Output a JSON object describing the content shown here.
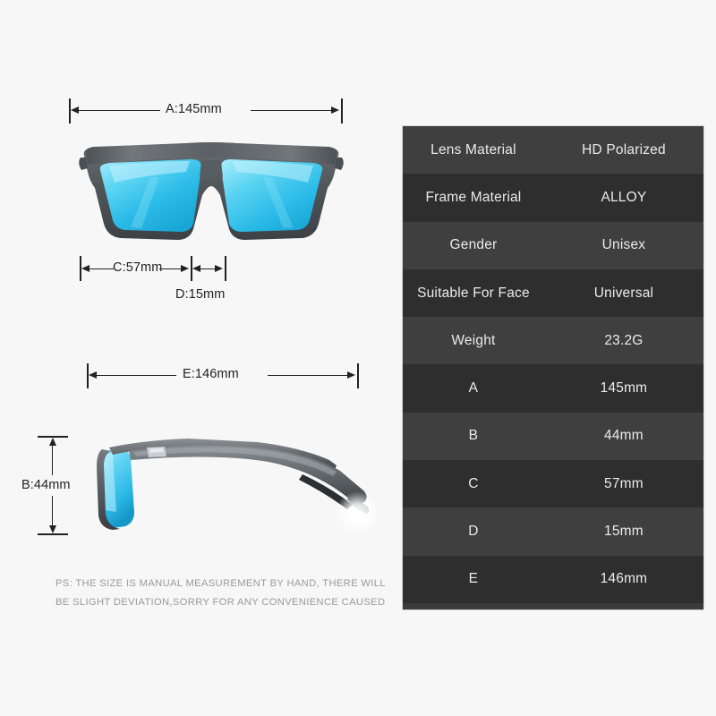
{
  "background_color": "#f7f7f7",
  "front_view": {
    "name": "sunglasses-front-view",
    "dimensions": {
      "a": {
        "label": "A:145mm",
        "axis": "horizontal"
      },
      "c": {
        "label": "C:57mm",
        "axis": "horizontal"
      },
      "d": {
        "label": "D:15mm",
        "axis": "horizontal"
      }
    },
    "colors": {
      "frame": "#53585c",
      "frame_dark": "#3d4246",
      "lens_light": "#8fe6f8",
      "lens_mid": "#35c3ea",
      "lens_deep": "#16a8d8"
    }
  },
  "side_view": {
    "name": "sunglasses-side-view",
    "dimensions": {
      "e": {
        "label": "E:146mm",
        "axis": "horizontal"
      },
      "b": {
        "label": "B:44mm",
        "axis": "vertical"
      }
    },
    "colors": {
      "temple": "#6b7075",
      "temple_dark": "#3a3e42",
      "lens_light": "#9ce8fa",
      "lens_deep": "#2bb6e4",
      "glare": "#ffffff"
    }
  },
  "note": {
    "line1": "PS: THE SIZE IS MANUAL MEASUREMENT BY HAND, THERE WILL",
    "line2": "BE SLIGHT DEVIATION,SORRY FOR ANY CONVENIENCE CAUSED",
    "color": "#9a9a9a"
  },
  "spec_table": {
    "name": "specification-table",
    "row_colors": {
      "odd": "#3f3f3f",
      "even": "#2e2e2e"
    },
    "text_color": "#eceaea",
    "border_color": "#d8d8d8",
    "rows": [
      {
        "key": "Lens Material",
        "value": "HD Polarized"
      },
      {
        "key": "Frame Material",
        "value": "ALLOY"
      },
      {
        "key": "Gender",
        "value": "Unisex"
      },
      {
        "key": "Suitable For Face",
        "value": "Universal"
      },
      {
        "key": "Weight",
        "value": "23.2G"
      },
      {
        "key": "A",
        "value": "145mm"
      },
      {
        "key": "B",
        "value": "44mm"
      },
      {
        "key": "C",
        "value": "57mm"
      },
      {
        "key": "D",
        "value": "15mm"
      },
      {
        "key": "E",
        "value": "146mm"
      }
    ]
  }
}
